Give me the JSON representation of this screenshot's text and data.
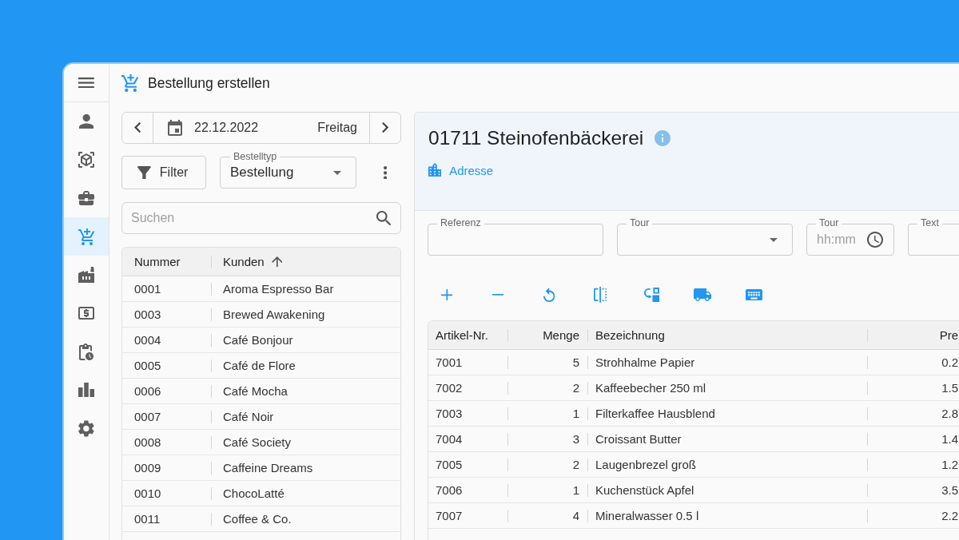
{
  "app_bar": {
    "title": "Bestellung erstellen"
  },
  "sidebar": {
    "items": [
      {
        "selected": false
      },
      {
        "selected": false
      },
      {
        "selected": false
      },
      {
        "selected": true
      },
      {
        "selected": false
      },
      {
        "selected": false
      },
      {
        "selected": false
      },
      {
        "selected": false
      },
      {
        "selected": false
      }
    ]
  },
  "date_nav": {
    "date": "22.12.2022",
    "weekday": "Freitag"
  },
  "filter_button": {
    "label": "Filter"
  },
  "order_type": {
    "label": "Bestelltyp",
    "value": "Bestellung"
  },
  "search": {
    "placeholder": "Suchen"
  },
  "customer_table": {
    "columns": [
      {
        "label": "Nummer",
        "sorted": false
      },
      {
        "label": "Kunden",
        "sorted": true
      }
    ],
    "rows": [
      [
        "0001",
        "Aroma Espresso Bar"
      ],
      [
        "0003",
        "Brewed Awakening"
      ],
      [
        "0004",
        "Café Bonjour"
      ],
      [
        "0005",
        "Café de Flore"
      ],
      [
        "0006",
        "Café Mocha"
      ],
      [
        "0007",
        "Café Noir"
      ],
      [
        "0008",
        "Café Society"
      ],
      [
        "0009",
        "Caffeine Dreams"
      ],
      [
        "0010",
        "ChocoLatté"
      ],
      [
        "0011",
        "Coffee & Co."
      ]
    ]
  },
  "customer": {
    "title": "01711 Steinofenbäckerei",
    "address_link": "Adresse"
  },
  "order_fields": [
    {
      "kind": "text",
      "label": "Referenz"
    },
    {
      "kind": "select",
      "label": "Tour"
    },
    {
      "kind": "time",
      "label": "Tour",
      "placeholder": "hh:mm"
    },
    {
      "kind": "text",
      "label": "Text"
    }
  ],
  "items_table": {
    "columns": [
      {
        "label": "Artikel-Nr."
      },
      {
        "label": "Menge"
      },
      {
        "label": "Bezeichnung"
      },
      {
        "label": "Pre"
      }
    ],
    "rows": [
      [
        "7001",
        "5",
        "Strohhalme Papier",
        "0.2"
      ],
      [
        "7002",
        "2",
        "Kaffeebecher 250 ml",
        "1.5"
      ],
      [
        "7003",
        "1",
        "Filterkaffee Hausblend",
        "2.8"
      ],
      [
        "7004",
        "3",
        "Croissant Butter",
        "1.4"
      ],
      [
        "7005",
        "2",
        "Laugenbrezel groß",
        "1.2"
      ],
      [
        "7006",
        "1",
        "Kuchenstück Apfel",
        "3.5"
      ],
      [
        "7007",
        "4",
        "Mineralwasser 0.5 l",
        "2.2"
      ]
    ]
  }
}
